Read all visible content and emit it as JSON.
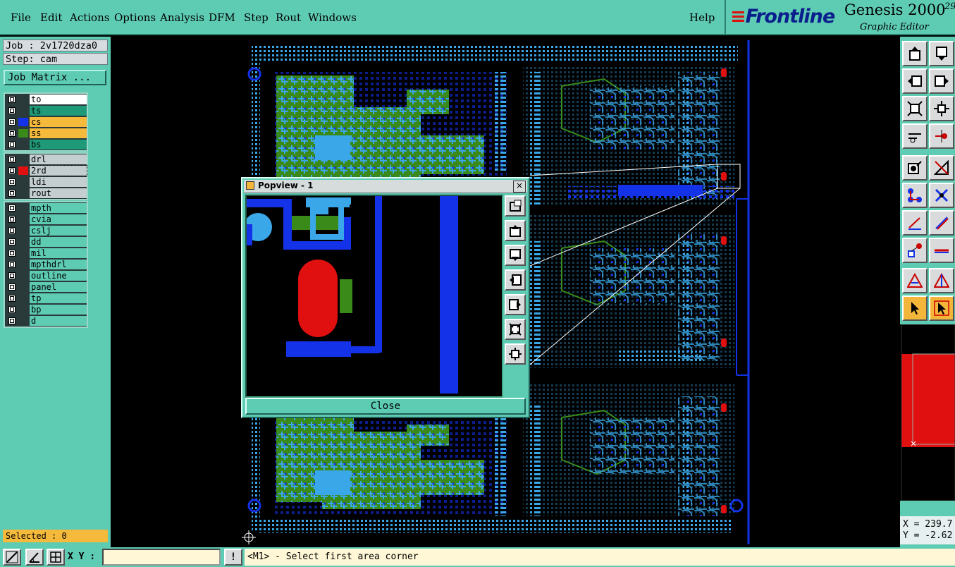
{
  "menubar": {
    "items": [
      "File",
      "Edit",
      "Actions",
      "Options",
      "Analysis",
      "DFM",
      "Step",
      "Rout",
      "Windows"
    ],
    "help": "Help"
  },
  "brand": {
    "logo": "Frontline",
    "product": "Genesis 2000",
    "subtitle": "Graphic Editor",
    "superscript": "29"
  },
  "job": {
    "job_line": "Job : 2v1720dza0",
    "step_line": "Step: cam",
    "matrix_button": "Job Matrix ..."
  },
  "layers": {
    "group1": [
      {
        "name": "to",
        "color": "#ffffff",
        "swatch": ""
      },
      {
        "name": "ts",
        "color": "#1f9a78",
        "swatch": ""
      },
      {
        "name": "cs",
        "color": "#f5b93c",
        "swatch": "#1432e8"
      },
      {
        "name": "ss",
        "color": "#f5b93c",
        "swatch": "#3a8a1a"
      },
      {
        "name": "bs",
        "color": "#1f9a78",
        "swatch": ""
      }
    ],
    "group2": [
      {
        "name": "drl",
        "color": "#c4cdd0",
        "swatch": ""
      },
      {
        "name": "2rd",
        "color": "#c4cdd0",
        "swatch": "#e01010",
        "active": true
      },
      {
        "name": "ldi",
        "color": "#c4cdd0",
        "swatch": ""
      },
      {
        "name": "rout",
        "color": "#c4cdd0",
        "swatch": ""
      }
    ],
    "group3": [
      {
        "name": "mpth",
        "color": "#5ecbb3",
        "swatch": ""
      },
      {
        "name": "cvia",
        "color": "#5ecbb3",
        "swatch": ""
      },
      {
        "name": "cslj",
        "color": "#5ecbb3",
        "swatch": ""
      },
      {
        "name": "dd",
        "color": "#5ecbb3",
        "swatch": ""
      },
      {
        "name": "mil",
        "color": "#5ecbb3",
        "swatch": ""
      },
      {
        "name": "mpthdrl",
        "color": "#5ecbb3",
        "swatch": ""
      },
      {
        "name": "outline",
        "color": "#5ecbb3",
        "swatch": ""
      },
      {
        "name": "panel",
        "color": "#5ecbb3",
        "swatch": ""
      },
      {
        "name": "tp",
        "color": "#5ecbb3",
        "swatch": ""
      },
      {
        "name": "bp",
        "color": "#5ecbb3",
        "swatch": ""
      },
      {
        "name": "d",
        "color": "#5ecbb3",
        "swatch": ""
      }
    ]
  },
  "selected": "Selected : 0",
  "popview": {
    "title": "Popview - 1",
    "close_label": "Close",
    "close_x": "×"
  },
  "coords": {
    "x": "X = 239.7",
    "y": "Y = -2.62"
  },
  "statusbar": {
    "xy_label": "X Y :",
    "xy_value": "",
    "alert": "!",
    "prompt": "<M1> - Select first area corner"
  },
  "colors": {
    "panel": "#5ecbb3",
    "copper_top": "#1432e8",
    "copper_light": "#3aa8e8",
    "solder_green": "#3a8a1a",
    "highlight_red": "#e01010",
    "active_orange": "#f3b53a"
  }
}
